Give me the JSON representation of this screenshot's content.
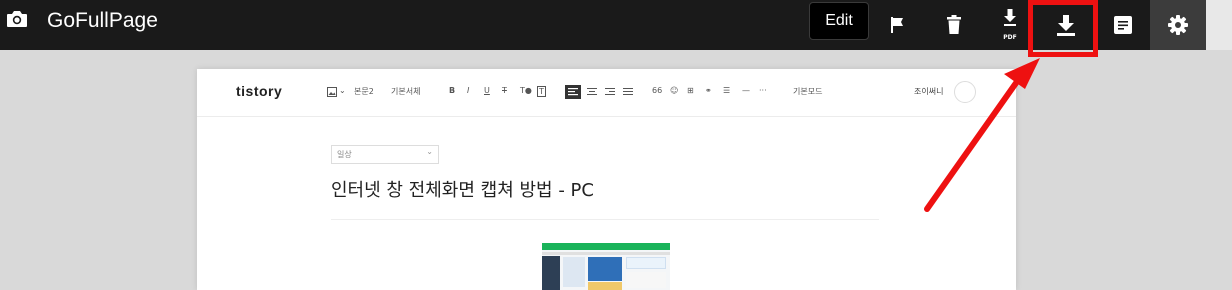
{
  "app": {
    "title": "GoFullPage"
  },
  "toolbar": {
    "edit_label": "Edit",
    "pdf_label": "PDF",
    "icons": [
      "camera-icon",
      "flag-icon",
      "trash-icon",
      "pdf-download-icon",
      "download-icon",
      "notes-icon",
      "gear-icon"
    ]
  },
  "colors": {
    "topbar": "#1a1a1a",
    "highlight": "#ee1111",
    "accent_green": "#19b35a"
  },
  "page": {
    "logo": "tistory",
    "toolbar": {
      "paragraph_style": "본문2",
      "font": "기본서체",
      "mode": "기본모드"
    },
    "user": "조이써니",
    "category": "일상",
    "post_title": "인터넷 창 전체화면 캡쳐 방법 - PC"
  }
}
